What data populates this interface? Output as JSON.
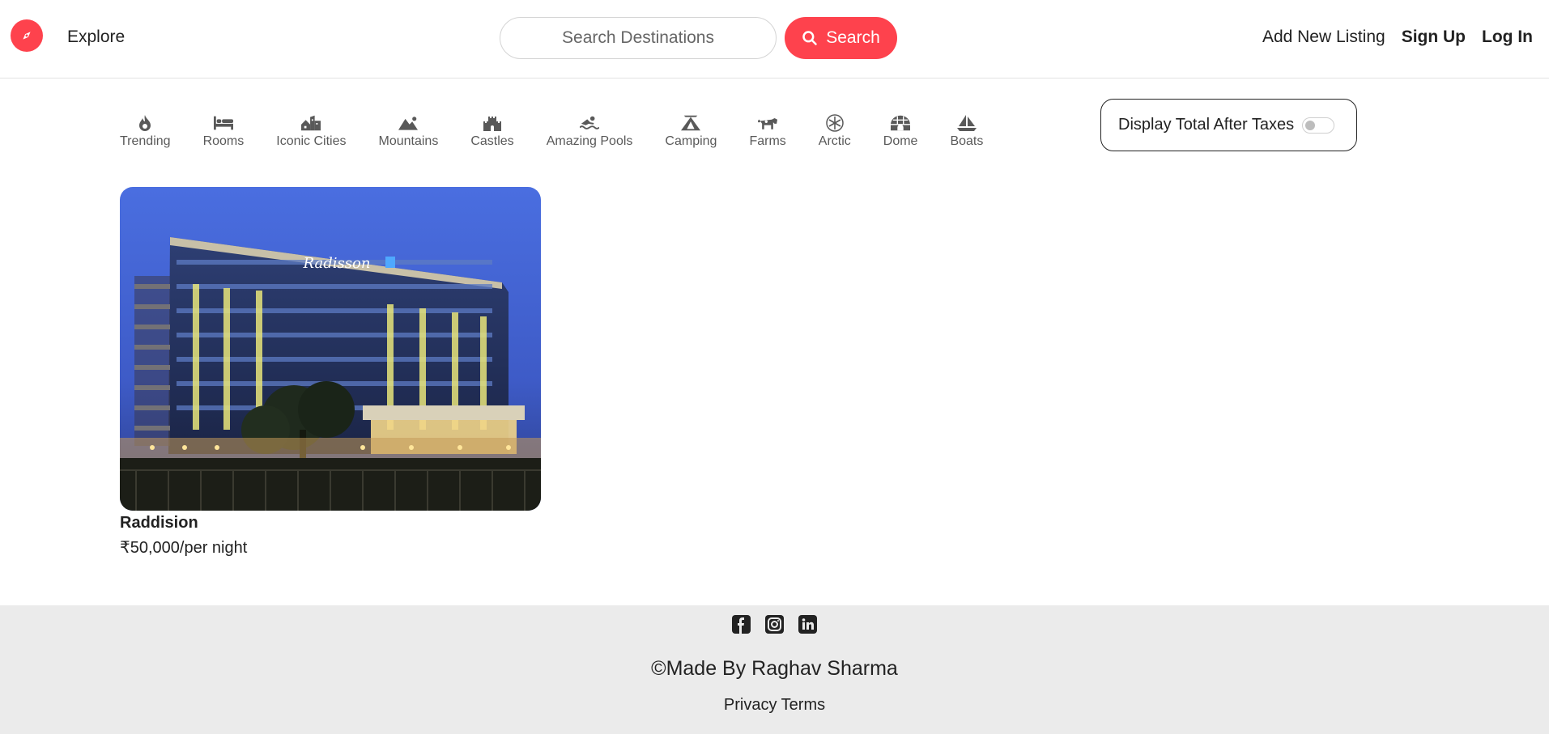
{
  "navbar": {
    "logo_icon": "compass-icon",
    "explore": "Explore",
    "search_placeholder": "Search Destinations",
    "search_button": "Search",
    "add_listing": "Add New Listing",
    "sign_up": "Sign Up",
    "log_in": "Log In",
    "accent": "#fe424d"
  },
  "filters": [
    {
      "label": "Trending",
      "icon": "fire-icon"
    },
    {
      "label": "Rooms",
      "icon": "bed-icon"
    },
    {
      "label": "Iconic Cities",
      "icon": "city-icon"
    },
    {
      "label": "Mountains",
      "icon": "mountain-icon"
    },
    {
      "label": "Castles",
      "icon": "castle-icon"
    },
    {
      "label": "Amazing Pools",
      "icon": "pool-icon"
    },
    {
      "label": "Camping",
      "icon": "tent-icon"
    },
    {
      "label": "Farms",
      "icon": "cow-icon"
    },
    {
      "label": "Arctic",
      "icon": "snowflake-icon"
    },
    {
      "label": "Dome",
      "icon": "igloo-icon"
    },
    {
      "label": "Boats",
      "icon": "sailboat-icon"
    }
  ],
  "tax_toggle": {
    "label": "Display Total After Taxes",
    "enabled": false
  },
  "listings": [
    {
      "title": "Raddision",
      "price": "₹50,000/per night",
      "image": "hotel-building-photo"
    }
  ],
  "footer": {
    "socials": [
      "facebook-icon",
      "instagram-icon",
      "linkedin-icon"
    ],
    "credit": "©Made By Raghav Sharma",
    "privacy": "Privacy",
    "terms": "Terms"
  }
}
